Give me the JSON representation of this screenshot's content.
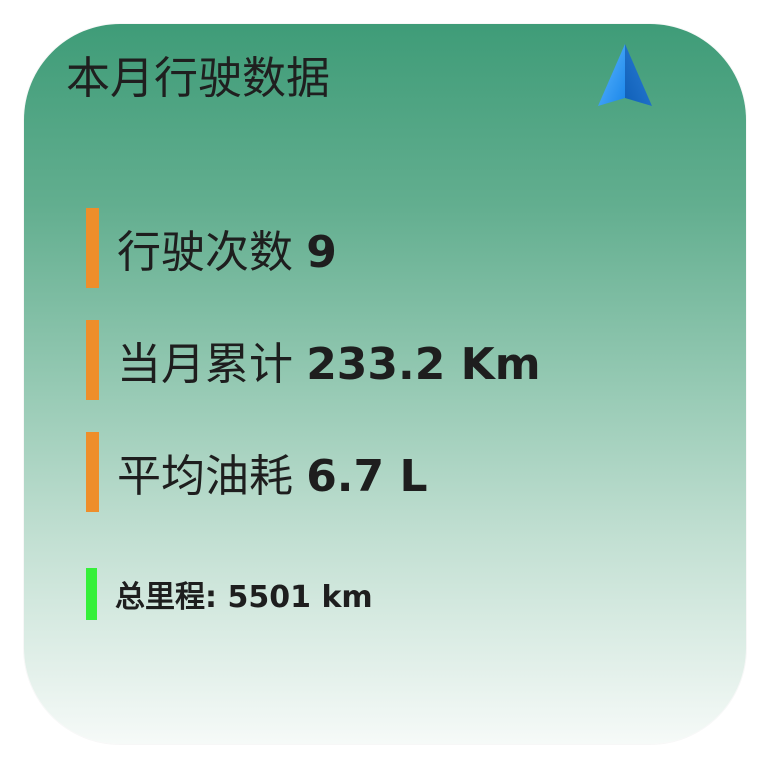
{
  "widget": {
    "title": "本月行驶数据",
    "icon": "navigation-arrow-icon",
    "colors": {
      "gradient_top": "#3f9c78",
      "gradient_bottom": "#f6faf8",
      "accent_bar": "#ee8e2a",
      "total_bar": "#35f03a",
      "icon_blue": "#1f8ef0"
    },
    "stats": [
      {
        "label": "行驶次数",
        "value": "9"
      },
      {
        "label": "当月累计",
        "value": "233.2 Km"
      },
      {
        "label": "平均油耗",
        "value": "6.7 L"
      }
    ],
    "total": {
      "label": "总里程:",
      "value": "5501 km"
    }
  }
}
